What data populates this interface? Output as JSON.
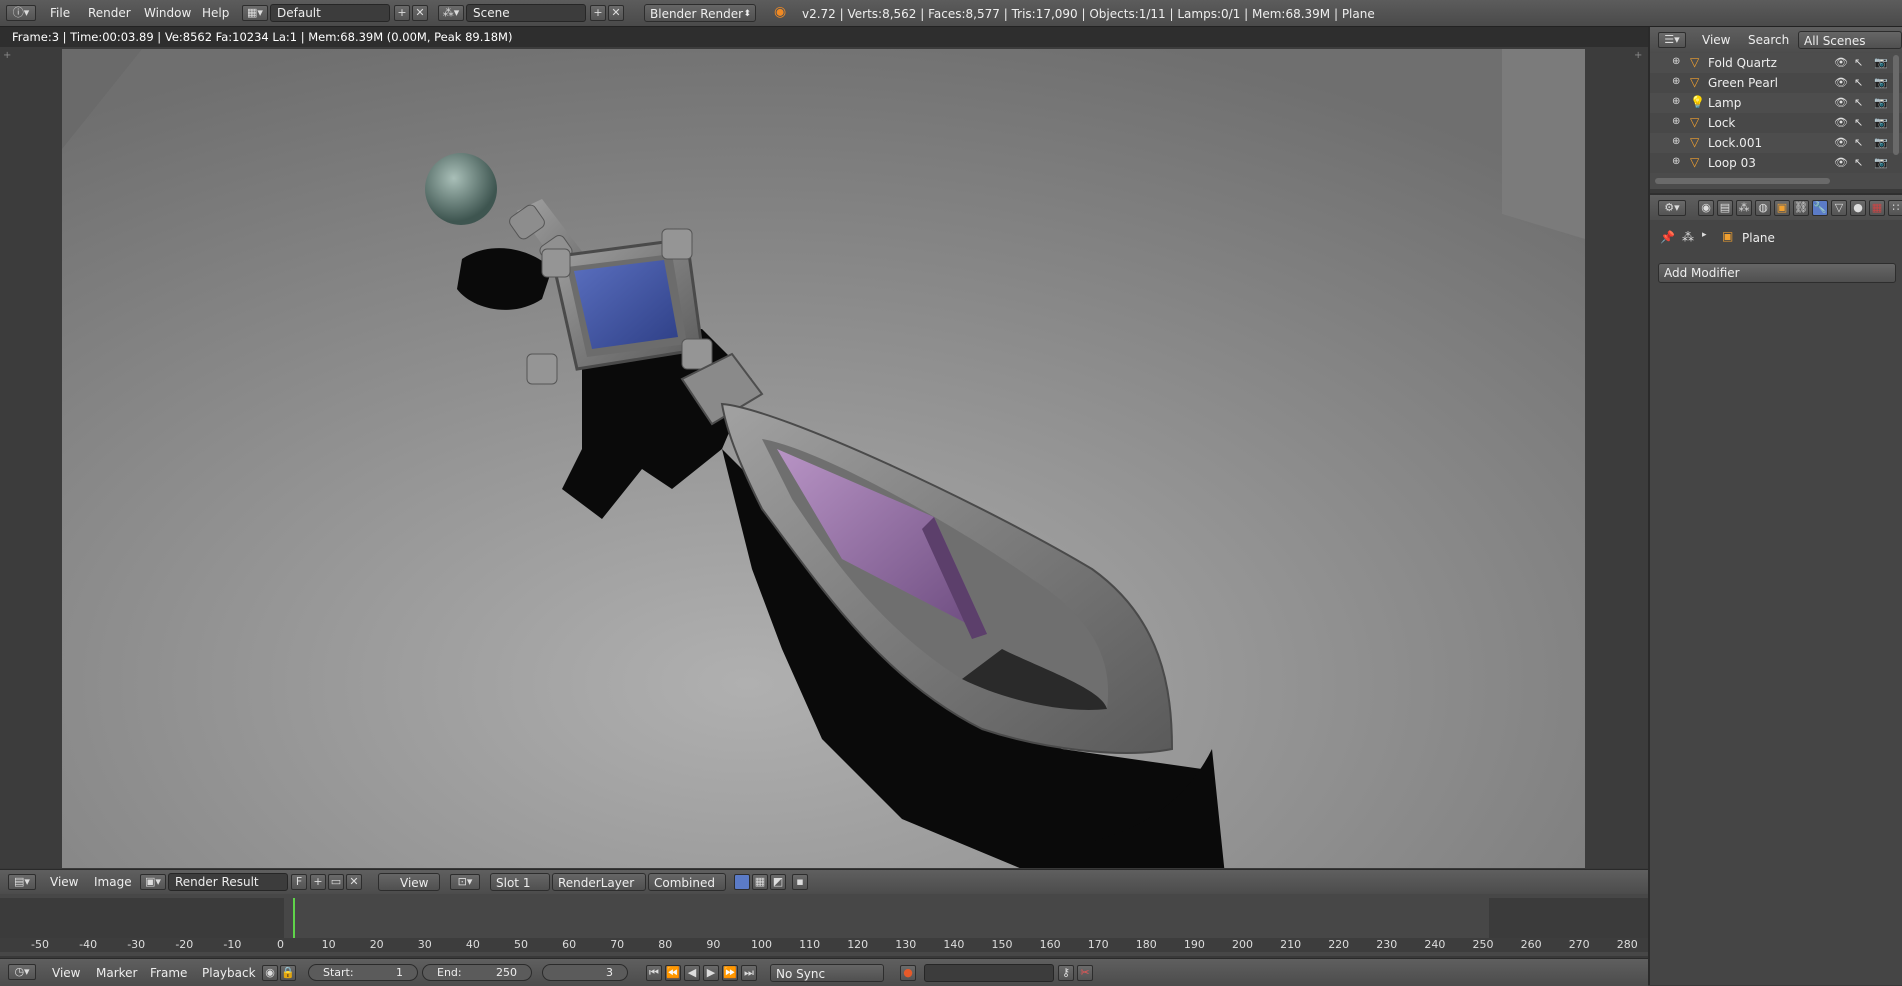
{
  "topbar": {
    "menu": [
      "File",
      "Render",
      "Window",
      "Help"
    ],
    "screen_layout": "Default",
    "scene": "Scene",
    "render_engine": "Blender Render",
    "stats": "v2.72 | Verts:8,562 | Faces:8,577 | Tris:17,090 | Objects:1/11 | Lamps:0/1 | Mem:68.39M | Plane"
  },
  "render": {
    "info": "Frame:3 | Time:00:03.89 | Ve:8562 Fa:10234 La:1 | Mem:68.39M (0.00M, Peak 89.18M)"
  },
  "image_header": {
    "menu": [
      "View",
      "Image"
    ],
    "image_name": "Render Result",
    "fake_user": "F",
    "view_label": "View",
    "slot": "Slot 1",
    "render_layer": "RenderLayer",
    "pass": "Combined"
  },
  "timeline": {
    "ticks": [
      "-50",
      "-40",
      "-30",
      "-20",
      "-10",
      "0",
      "10",
      "20",
      "30",
      "40",
      "50",
      "60",
      "70",
      "80",
      "90",
      "100",
      "110",
      "120",
      "130",
      "140",
      "150",
      "160",
      "170",
      "180",
      "190",
      "200",
      "210",
      "220",
      "230",
      "240",
      "250",
      "260",
      "270",
      "280"
    ],
    "current_frame_marker": 3
  },
  "timeline_header": {
    "menu": [
      "View",
      "Marker",
      "Frame",
      "Playback"
    ],
    "start_label": "Start:",
    "start": "1",
    "end_label": "End:",
    "end": "250",
    "current": "3",
    "sync": "No Sync"
  },
  "outliner": {
    "menu": [
      "View",
      "Search"
    ],
    "filter": "All Scenes",
    "items": [
      "Fold Quartz",
      "Green Pearl",
      "Lamp",
      "Lock",
      "Lock.001",
      "Loop 03"
    ]
  },
  "properties": {
    "context_object": "Plane",
    "add_modifier": "Add Modifier"
  },
  "colors": {
    "accent_green": "#5fd44a",
    "blue_gem": "#3a4f9c",
    "purple_gem": "#8a5f9a"
  }
}
